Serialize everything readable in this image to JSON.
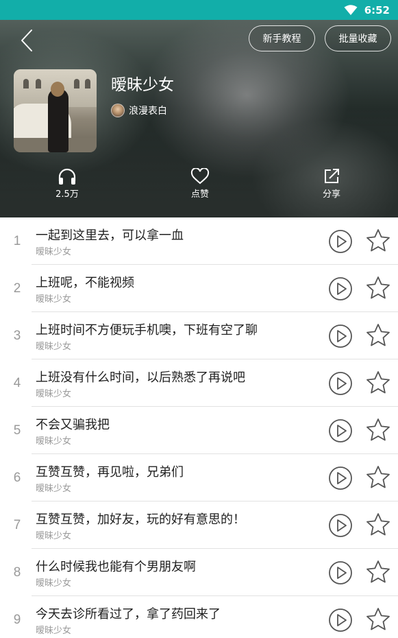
{
  "status_bar": {
    "time": "6:52",
    "wifi_icon": "wifi-icon"
  },
  "header": {
    "back_icon": "chevron-left-icon",
    "tutorial_label": "新手教程",
    "batch_collect_label": "批量收藏",
    "album_title": "暧昧少女",
    "author_name": "浪漫表白",
    "stats": {
      "listens": "2.5万",
      "like_label": "点赞",
      "share_label": "分享"
    }
  },
  "tracks": [
    {
      "num": "1",
      "title": "一起到这里去，可以拿一血",
      "subtitle": "暧昧少女"
    },
    {
      "num": "2",
      "title": "上班呢，不能视频",
      "subtitle": "暧昧少女"
    },
    {
      "num": "3",
      "title": "上班时间不方便玩手机噢，下班有空了聊",
      "subtitle": "暧昧少女"
    },
    {
      "num": "4",
      "title": "上班没有什么时间，以后熟悉了再说吧",
      "subtitle": "暧昧少女"
    },
    {
      "num": "5",
      "title": "不会又骗我把",
      "subtitle": "暧昧少女"
    },
    {
      "num": "6",
      "title": "互赞互赞，再见啦，兄弟们",
      "subtitle": "暧昧少女"
    },
    {
      "num": "7",
      "title": "互赞互赞，加好友，玩的好有意思的！",
      "subtitle": "暧昧少女"
    },
    {
      "num": "8",
      "title": "什么时候我也能有个男朋友啊",
      "subtitle": "暧昧少女"
    },
    {
      "num": "9",
      "title": "今天去诊所看过了，拿了药回来了",
      "subtitle": "暧昧少女"
    }
  ],
  "colors": {
    "status_bar": "#12aea9",
    "icon_stroke": "#555555"
  }
}
